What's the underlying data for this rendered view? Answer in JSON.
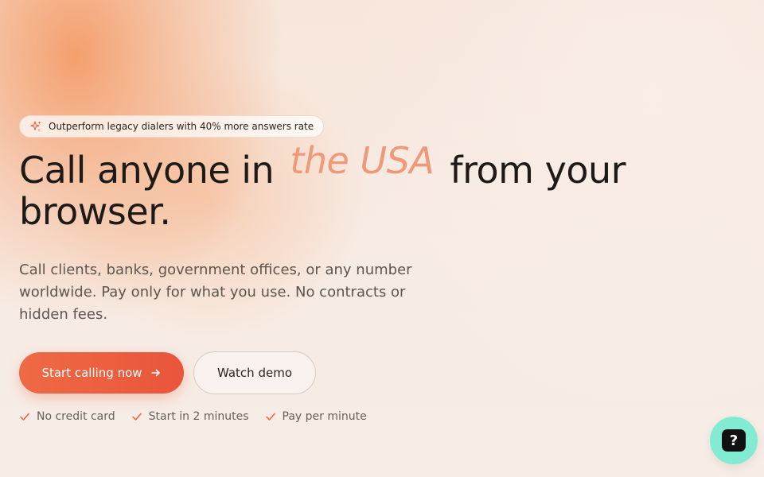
{
  "colors": {
    "accent": "#e9553a",
    "headline_accent": "#ee9a78",
    "help_button": "#82ecd3",
    "check": "#e9623f"
  },
  "badge": {
    "icon": "sparkle-icon",
    "text": "Outperform legacy dialers with 40% more answers rate"
  },
  "hero": {
    "title_part1": "Call anyone in",
    "title_accent": "the USA",
    "title_part2": "from your browser.",
    "subtitle": "Call clients, banks, government offices, or any number worldwide. Pay only for what you use. No contracts or hidden fees."
  },
  "cta": {
    "primary_label": "Start calling now",
    "primary_icon": "arrow-right-icon",
    "secondary_label": "Watch demo"
  },
  "perks": [
    {
      "icon": "check-icon",
      "label": "No credit card"
    },
    {
      "icon": "check-icon",
      "label": "Start in 2 minutes"
    },
    {
      "icon": "check-icon",
      "label": "Pay per minute"
    }
  ],
  "help": {
    "icon": "question-mark-icon",
    "glyph": "?"
  }
}
